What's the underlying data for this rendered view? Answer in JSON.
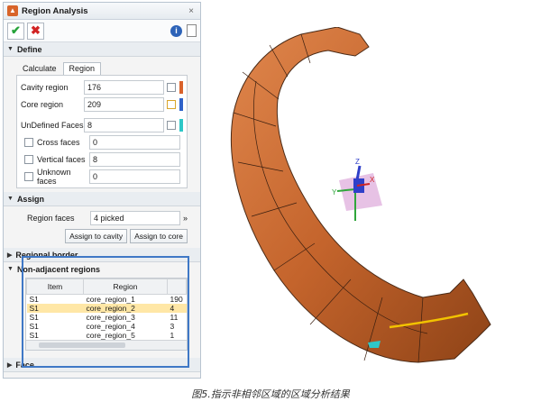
{
  "window": {
    "title": "Region Analysis",
    "close": "×"
  },
  "toolbar": {
    "ok": "✔",
    "cancel": "✖",
    "info": "i"
  },
  "sections": {
    "define": "Define",
    "assign": "Assign",
    "regional_border": "Regional border",
    "non_adjacent": "Non-adjacent regions",
    "face": "Face"
  },
  "tabs": [
    "Calculate",
    "Region"
  ],
  "regions": [
    {
      "label": "Cavity region",
      "value": "176",
      "color": "#d9622b"
    },
    {
      "label": "Core region",
      "value": "209",
      "color": "#2f62c9"
    }
  ],
  "undefined_faces": {
    "label": "UnDefined Faces",
    "value": "8",
    "color": "#2ec7c7"
  },
  "sub_faces": [
    {
      "label": "Cross faces",
      "value": "0"
    },
    {
      "label": "Vertical faces",
      "value": "8"
    },
    {
      "label": "Unknown faces",
      "value": "0"
    }
  ],
  "assign": {
    "label": "Region faces",
    "value": "4 picked",
    "btn_cavity": "Assign to cavity",
    "btn_core": "Assign to core"
  },
  "table": {
    "columns": [
      "Item",
      "Region"
    ],
    "rows": [
      [
        "S1",
        "core_region_1",
        "190"
      ],
      [
        "S1",
        "core_region_2",
        "4"
      ],
      [
        "S1",
        "core_region_3",
        "11"
      ],
      [
        "S1",
        "core_region_4",
        "3"
      ],
      [
        "S1",
        "core_region_5",
        "1"
      ]
    ],
    "selected_row": 1
  },
  "caption": "图5.指示非相邻区域的区域分析结果",
  "axes": {
    "x": "X",
    "y": "Y",
    "z": "Z"
  }
}
